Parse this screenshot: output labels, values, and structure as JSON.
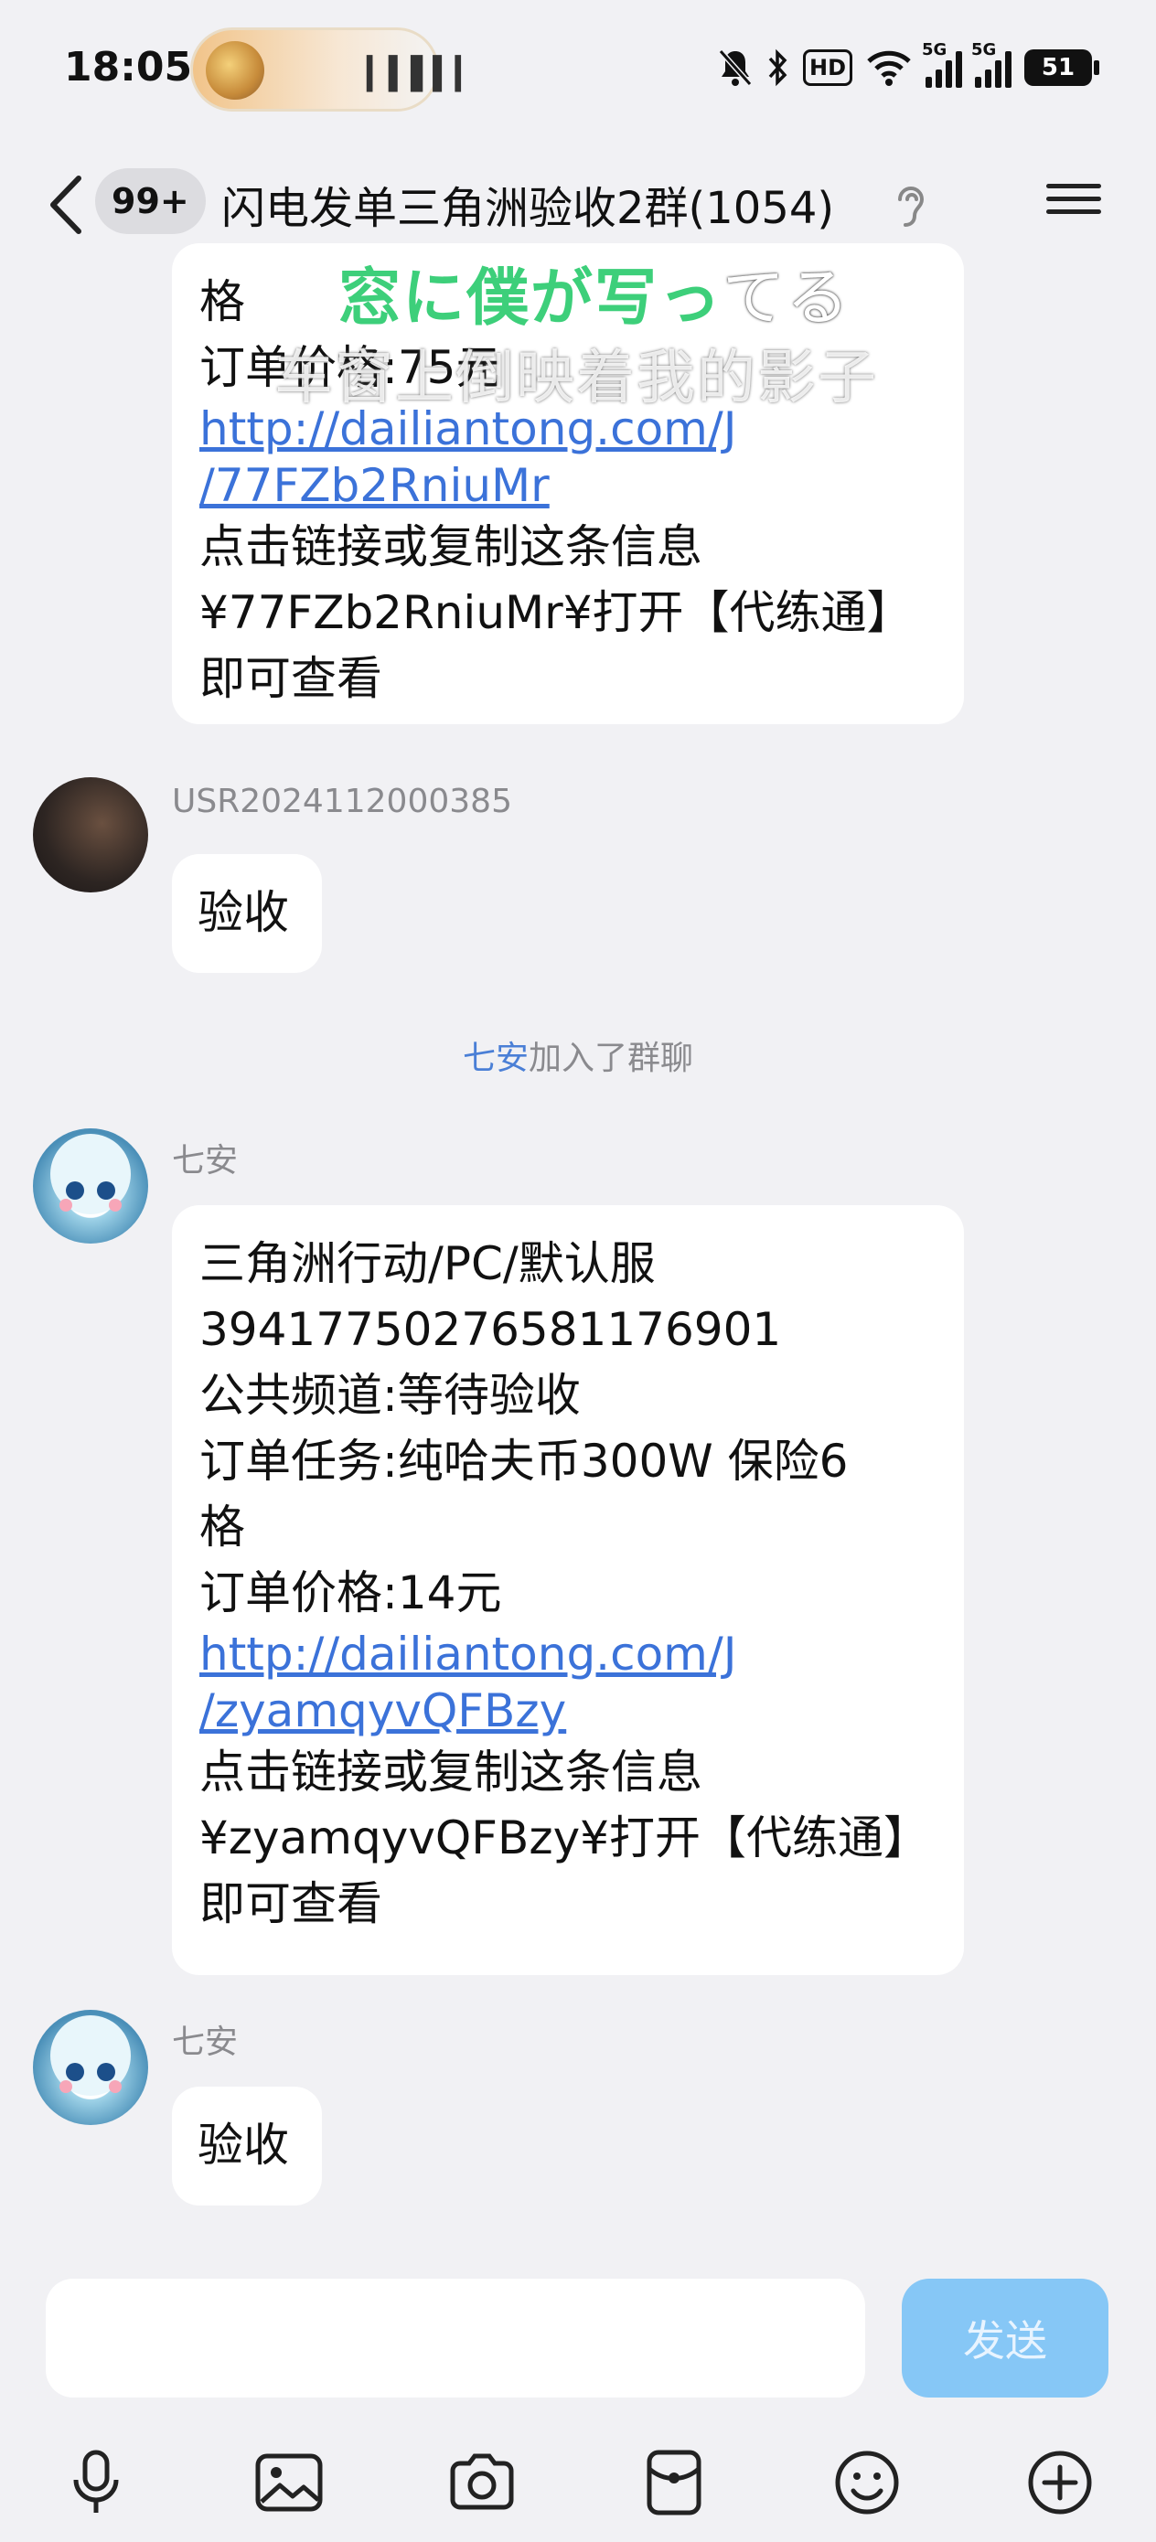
{
  "status_bar": {
    "time": "18:05",
    "hd_label": "HD",
    "signal_label_1": "5G",
    "signal_label_2": "5G",
    "battery": "51"
  },
  "header": {
    "unread_badge": "99+",
    "title": "闪电发单三角洲验收2群(1054)"
  },
  "lyrics": {
    "line1_highlight": "窓に僕が写っ",
    "line1_rest": "てる",
    "line2": "车窗上倒映着我的影子"
  },
  "messages": [
    {
      "type": "bubble",
      "lines": [
        "格",
        "订单价格:75元"
      ],
      "link_lines": [
        "http://dailiantong.com/J",
        "/77FZb2RniuMr"
      ],
      "tail_lines": [
        "点击链接或复制这条信息",
        "¥77FZb2RniuMr¥打开【代练通】",
        "即可查看"
      ]
    },
    {
      "type": "message",
      "sender": "USR2024112000385",
      "text": "验收"
    },
    {
      "type": "system",
      "who": "七安",
      "text": "加入了群聊"
    },
    {
      "type": "message",
      "sender": "七安",
      "lines": [
        "三角洲行动/PC/默认服",
        "394177502765811769​01",
        "公共频道:等待验收",
        "订单任务:纯哈夫币300W   保险6",
        "格",
        "订单价格:14元"
      ],
      "link_lines": [
        "http://dailiantong.com/J",
        "/zyamqyvQFBzy"
      ],
      "tail_lines": [
        "点击链接或复制这条信息",
        "¥zyamqyvQFBzy¥打开【代练通】",
        "即可查看"
      ]
    },
    {
      "type": "message",
      "sender": "七安",
      "text": "验收"
    }
  ],
  "input_bar": {
    "send_label": "发送"
  },
  "toolbar": {
    "icons": [
      "microphone-icon",
      "image-icon",
      "camera-icon",
      "red-packet-icon",
      "emoji-icon",
      "plus-icon"
    ]
  },
  "colors": {
    "background": "#f1f1f4",
    "link": "#3b72d9",
    "send_button": "#86c7f6",
    "lyric_green": "#3dcf7a"
  }
}
